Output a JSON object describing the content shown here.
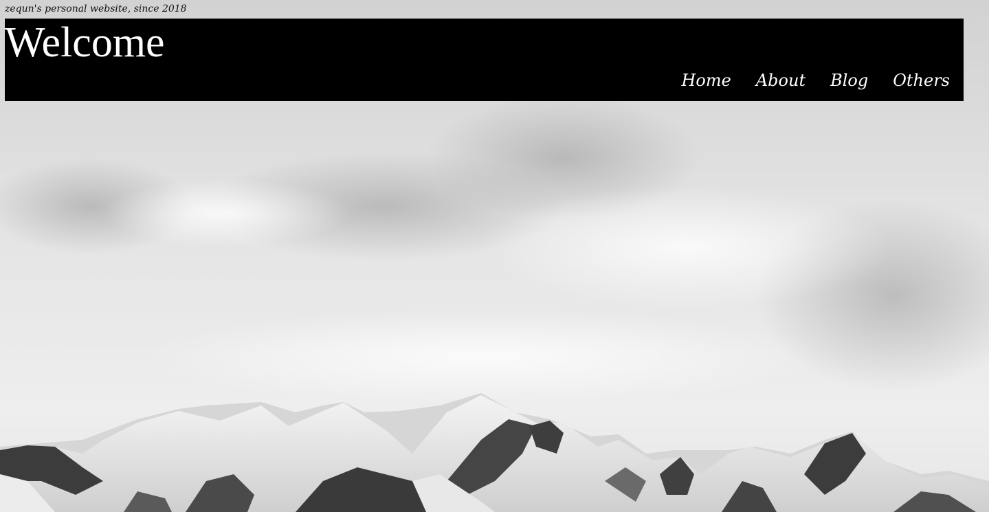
{
  "site": {
    "tagline": "zequn's personal website, since 2018",
    "title": "Welcome"
  },
  "nav": {
    "items": [
      {
        "label": "Home"
      },
      {
        "label": "About"
      },
      {
        "label": "Blog"
      },
      {
        "label": "Others"
      }
    ]
  },
  "colors": {
    "header_bg": "#000000",
    "header_text": "#ffffff",
    "sky": "#d8d8d8"
  }
}
